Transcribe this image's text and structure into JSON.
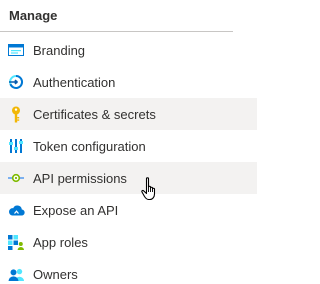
{
  "section": {
    "title": "Manage"
  },
  "menu": {
    "items": [
      {
        "label": "Branding",
        "icon": "branding-icon"
      },
      {
        "label": "Authentication",
        "icon": "authentication-icon"
      },
      {
        "label": "Certificates & secrets",
        "icon": "key-icon"
      },
      {
        "label": "Token configuration",
        "icon": "token-configuration-icon"
      },
      {
        "label": "API permissions",
        "icon": "api-permissions-icon"
      },
      {
        "label": "Expose an API",
        "icon": "cloud-icon"
      },
      {
        "label": "App roles",
        "icon": "app-roles-icon"
      },
      {
        "label": "Owners",
        "icon": "owners-icon"
      }
    ]
  },
  "colors": {
    "hover_background": "#f3f2f1",
    "text": "#323130",
    "divider": "#c8c6c4"
  }
}
